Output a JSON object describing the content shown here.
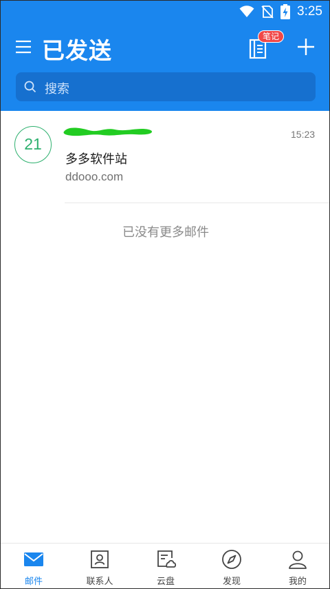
{
  "status_bar": {
    "time": "3:25",
    "icons": [
      "wifi-icon",
      "no-sim-icon",
      "battery-charging-icon"
    ]
  },
  "header": {
    "title": "已发送",
    "menu_icon": "hamburger-menu-icon",
    "notes_icon": "notebook-icon",
    "notes_badge": "笔记",
    "add_icon": "plus-icon"
  },
  "search": {
    "placeholder": "搜索",
    "icon": "search-icon"
  },
  "mails": [
    {
      "avatar_text": "21",
      "sender": "",
      "time": "15:23",
      "subject": "多多软件站",
      "preview": "ddooo.com"
    }
  ],
  "list_footer": "已没有更多邮件",
  "bottom_nav": [
    {
      "label": "邮件",
      "icon": "mail-icon",
      "active": true
    },
    {
      "label": "联系人",
      "icon": "contacts-icon",
      "active": false
    },
    {
      "label": "云盘",
      "icon": "cloud-drive-icon",
      "active": false
    },
    {
      "label": "发现",
      "icon": "compass-icon",
      "active": false
    },
    {
      "label": "我的",
      "icon": "profile-icon",
      "active": false
    }
  ],
  "colors": {
    "header_bg": "#1a86ee",
    "search_bg": "#1670cf",
    "accent": "#1a86ee",
    "avatar_green": "#2db06e",
    "badge_red": "#f04848",
    "redaction_green": "#22cc22"
  }
}
